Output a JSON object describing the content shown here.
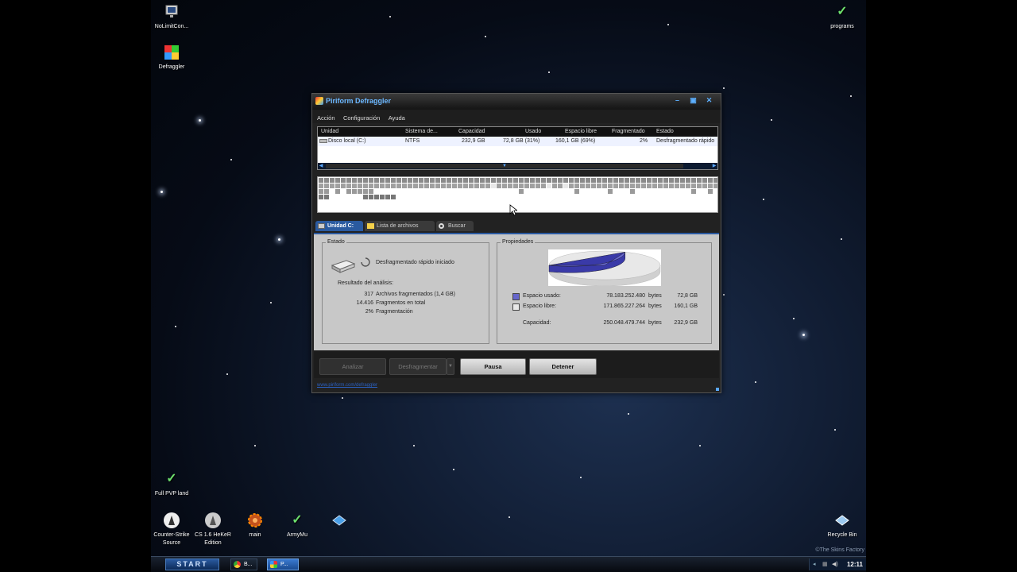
{
  "desktop": {
    "icons": [
      {
        "id": "nolimit",
        "label": "NoLimitCon...",
        "icon": "monitor-icon"
      },
      {
        "id": "defraggler",
        "label": "Defraggler",
        "icon": "defraggler-icon"
      },
      {
        "id": "programs",
        "label": "programs",
        "icon": "v-logo-icon"
      },
      {
        "id": "fullpvp",
        "label": "Full PVP land",
        "icon": "v-logo-icon"
      },
      {
        "id": "css",
        "label": "Counter-Strike Source",
        "icon": "counter-strike-icon"
      },
      {
        "id": "cs16",
        "label": "CS 1.6 HeKeR Edition",
        "icon": "counter-strike-icon"
      },
      {
        "id": "main",
        "label": "main",
        "icon": "gear-icon"
      },
      {
        "id": "armymu",
        "label": "ArmyMu",
        "icon": "v-logo-icon"
      },
      {
        "id": "blank",
        "label": "",
        "icon": "diamond-icon"
      },
      {
        "id": "recycle",
        "label": "Recycle Bin",
        "icon": "recycle-bin-icon"
      }
    ],
    "watermark": "©The Skins Factory"
  },
  "taskbar": {
    "start_label": "START",
    "tasks": [
      {
        "label": "B...",
        "icon": "chrome-icon",
        "active": false
      },
      {
        "label": "P...",
        "icon": "defraggler-icon",
        "active": true
      }
    ],
    "clock": "12:11"
  },
  "window": {
    "title": "Piriform Defraggler",
    "menu": [
      "Acción",
      "Configuración",
      "Ayuda"
    ],
    "drive_table": {
      "columns": [
        "Unidad",
        "Sistema de...",
        "Capacidad",
        "Usado",
        "Espacio libre",
        "Fragmentado",
        "Estado"
      ],
      "rows": [
        [
          "Disco local (C:)",
          "NTFS",
          "232,9 GB",
          "72,8 GB (31%)",
          "160,1 GB (69%)",
          "2%",
          "Desfragmentado rápido"
        ]
      ]
    },
    "tabs": [
      "Unidad C:",
      "Lista de archivos",
      "Buscar"
    ],
    "estado": {
      "legend": "Estado",
      "status": "Desfragmentado rápido iniciado",
      "results_title": "Resultado del análisis:",
      "results": [
        {
          "value": "317",
          "label": "Archivos fragmentados (1,4 GB)"
        },
        {
          "value": "14.416",
          "label": "Fragmentos en total"
        },
        {
          "value": "2%",
          "label": "Fragmentación"
        }
      ]
    },
    "propiedades": {
      "legend": "Propiedades",
      "used_label": "Espacio usado:",
      "used_bytes": "78.183.252.480",
      "used_unit": "bytes",
      "used_gb": "72,8 GB",
      "free_label": "Espacio libre:",
      "free_bytes": "171.865.227.264",
      "free_unit": "bytes",
      "free_gb": "160,1 GB",
      "cap_label": "Capacidad:",
      "cap_bytes": "250.048.479.744",
      "cap_unit": "bytes",
      "cap_gb": "232,9 GB",
      "used_color": "#6666cc",
      "free_color": "#e8e8e8",
      "used_fraction": 0.31
    },
    "buttons": {
      "analizar": "Analizar",
      "desfragmentar": "Desfragmentar",
      "pausa": "Pausa",
      "detener": "Detener"
    },
    "status_link": "www.piriform.com/defraggler"
  }
}
